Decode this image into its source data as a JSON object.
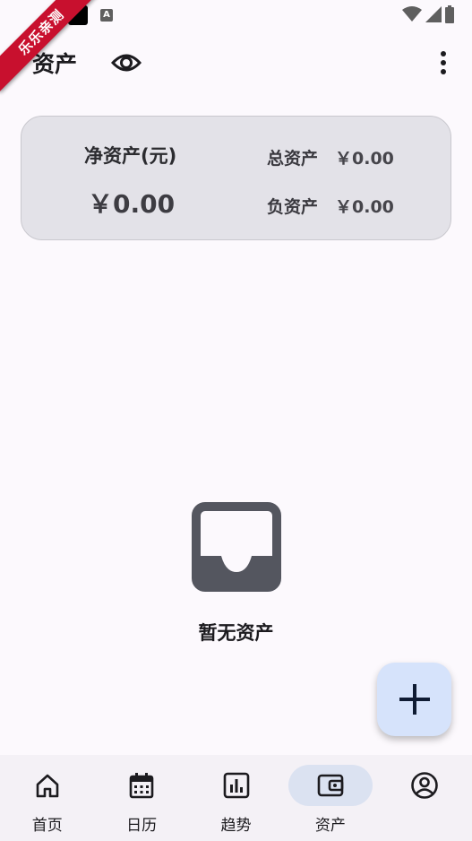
{
  "watermark": {
    "text": "乐乐亲测"
  },
  "status_bar": {
    "icons": [
      "notification-square-icon",
      "a-badge-icon",
      "wifi-icon",
      "signal-icon",
      "battery-icon"
    ]
  },
  "app_bar": {
    "title": "资产",
    "icons": [
      "eye-icon",
      "more-vert-icon"
    ]
  },
  "summary": {
    "net_label": "净资产(元)",
    "net_value": "￥0.00",
    "total_label": "总资产",
    "total_value": "￥0.00",
    "debt_label": "负资产",
    "debt_value": "￥0.00"
  },
  "empty_state": {
    "icon": "inbox-tray-icon",
    "text": "暂无资产"
  },
  "fab": {
    "icon": "plus-icon"
  },
  "bottom_nav": {
    "items": [
      {
        "label": "首页",
        "icon": "home-icon"
      },
      {
        "label": "日历",
        "icon": "calendar-icon"
      },
      {
        "label": "趋势",
        "icon": "chart-icon"
      },
      {
        "label": "资产",
        "icon": "wallet-icon",
        "active": true
      },
      {
        "label": "",
        "icon": "account-circle-icon"
      }
    ]
  },
  "colors": {
    "background": "#fcf9fd",
    "card": "#e3e2e8",
    "fab": "#d6e3fb",
    "nav_active_pill": "#dbe2f1",
    "watermark": "#c8102e"
  }
}
